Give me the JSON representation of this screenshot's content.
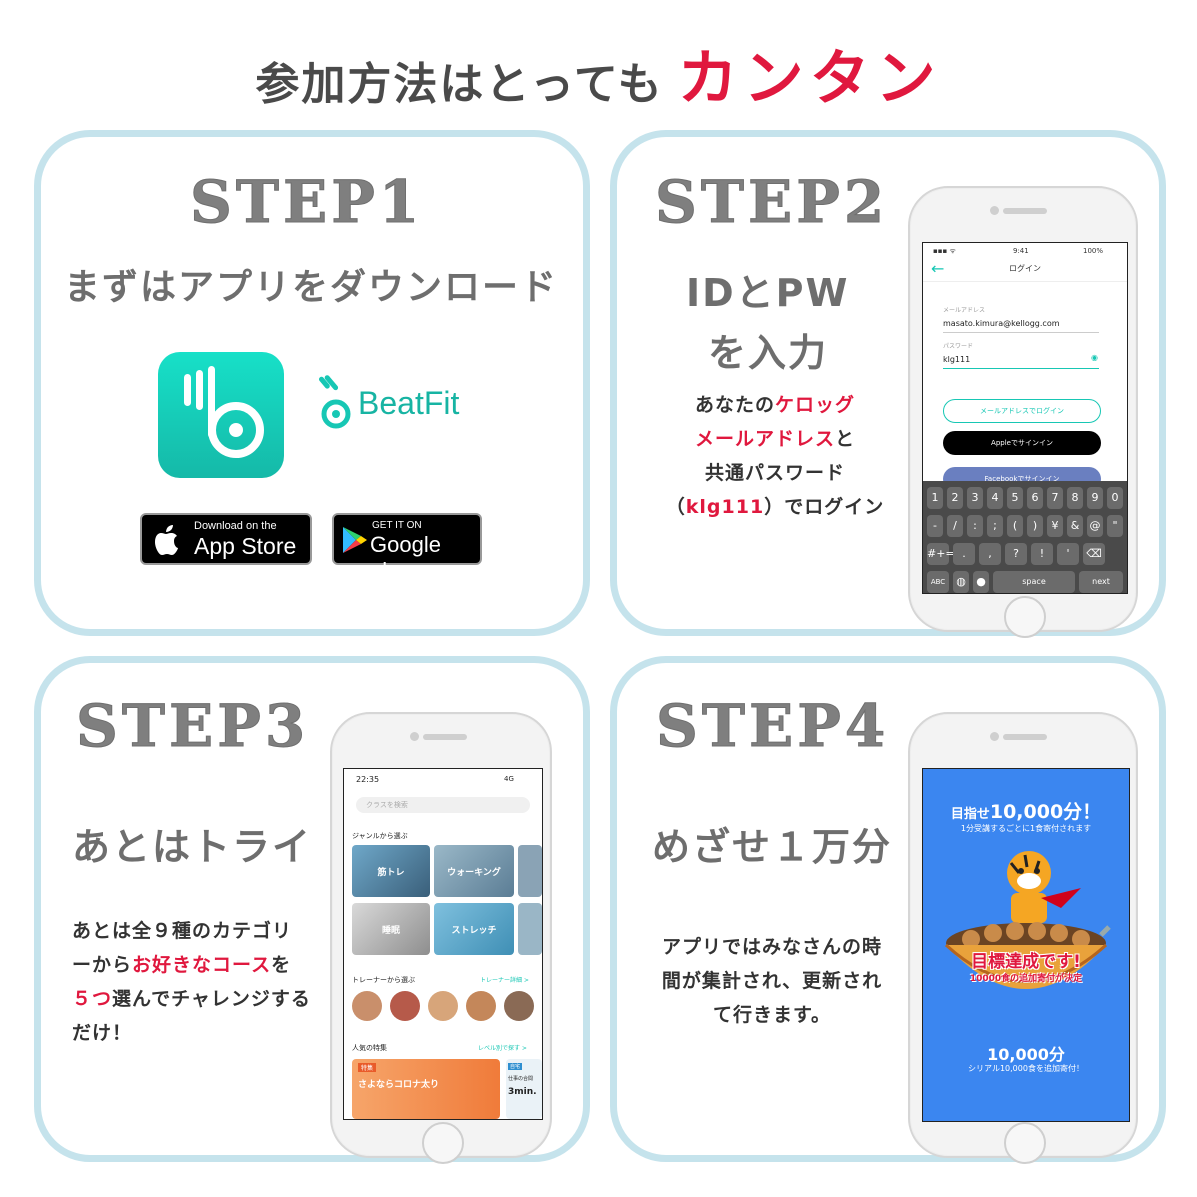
{
  "headline": {
    "main": "参加方法はとっても",
    "accent": "カンタン"
  },
  "step1": {
    "title": "STEP1",
    "subtitle": "まずはアプリをダウンロード",
    "brand": "BeatFit",
    "appstore_small": "Download on the",
    "appstore_big": "App Store",
    "googleplay_small": "GET IT ON",
    "googleplay_big": "Google play"
  },
  "step2": {
    "title": "STEP2",
    "subtitle_line1": "IDとPW",
    "subtitle_line2": "を入力",
    "desc": {
      "l1_pre": "あなたの",
      "l1_red": "ケロッグ",
      "l2_red": "メールアドレス",
      "l2_post": "と",
      "l3": "共通パスワード",
      "l4_pre": "（",
      "l4_red": "klg111",
      "l4_post": "）でログイン"
    },
    "phone": {
      "time": "9:41",
      "battery": "100%",
      "screen_title": "ログイン",
      "email_label": "メールアドレス",
      "email_value": "masato.kimura@kellogg.com",
      "pw_label": "パスワード",
      "pw_value": "klg111",
      "email_login_button": "メールアドレスでログイン",
      "apple_button": "Appleでサインイン",
      "facebook_button": "Facebookでサインイン",
      "keys_row1": [
        "1",
        "2",
        "3",
        "4",
        "5",
        "6",
        "7",
        "8",
        "9",
        "0"
      ],
      "keys_row2": [
        "-",
        "/",
        ":",
        ";",
        "(",
        ")",
        "¥",
        "&",
        "@",
        "\""
      ],
      "keys_row3": [
        "#+=",
        ".",
        ",",
        "?",
        "!",
        "'",
        "⌫"
      ],
      "key_abc": "ABC",
      "key_space": "space",
      "key_next": "next"
    }
  },
  "step3": {
    "title": "STEP3",
    "subtitle": "あとはトライ",
    "desc": {
      "l1": "あとは全９種のカテゴリ",
      "l2_pre": "ーから",
      "l2_red": "お好きなコース",
      "l2_post": "を",
      "l3_red": "５つ",
      "l3_post": "選んでチャレンジする",
      "l4": "だけ！"
    },
    "phone": {
      "time": "22:35",
      "signal": "4G",
      "search_placeholder": "クラスを検索",
      "genre_heading": "ジャンルから選ぶ",
      "genres": [
        "筋トレ",
        "ウォーキング",
        "睡眠",
        "ストレッチ"
      ],
      "trainer_heading": "トレーナーから選ぶ",
      "trainer_link": "トレーナー詳細 >",
      "feature_heading": "人気の特集",
      "feature_link": "レベル別で探す >",
      "feature_tag": "特集",
      "feature_title": "さよならコロナ太り",
      "feature2_tag": "自宅",
      "feature2_text": "仕事の合間",
      "feature2_time": "3min."
    }
  },
  "step4": {
    "title": "STEP4",
    "subtitle": "めざせ１万分",
    "desc": {
      "l1": "アプリではみなさんの時",
      "l2": "間が集計され、更新され",
      "l3": "て行きます。"
    },
    "phone": {
      "goal_pre": "目指せ",
      "goal_num": "10,000分！",
      "goal_sub": "1分受講するごとに1食寄付されます",
      "achieved": "目標達成です!",
      "achieved_sub": "10000食の追加寄付が決定",
      "total": "10,000分",
      "total_sub": "シリアル10,000食を追加寄付！"
    }
  },
  "colors": {
    "accent_red": "#e0183e",
    "card_border": "#c5e3ec",
    "teal": "#17c7b4",
    "step4_blue": "#3b86f0"
  }
}
